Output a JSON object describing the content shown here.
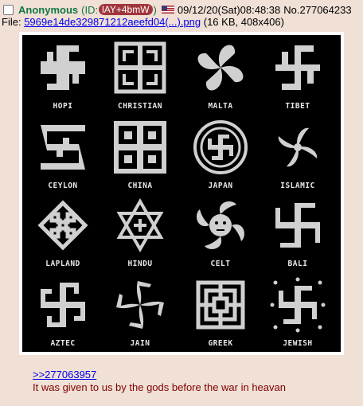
{
  "post": {
    "name": "Anonymous",
    "id_prefix": "(ID:",
    "id_value": "lAY+4bmW",
    "id_suffix": ")",
    "flag_icon": "us-flag-icon",
    "datetime": "09/12/20(Sat)08:48:38",
    "number": "No.277064233",
    "file_label": "File:",
    "file_name": "5969e14de329871212aeefd04(...).png",
    "file_info": "(16 KB, 408x406)",
    "quote_link": ">>277063957",
    "comment": "It was given to us by the gods before the war in heavan"
  },
  "image": {
    "labels": [
      "HOPI",
      "CHRISTIAN",
      "MALTA",
      "TIBET",
      "CEYLON",
      "CHINA",
      "JAPAN",
      "ISLAMIC",
      "LAPLAND",
      "HINDU",
      "CELT",
      "BALI",
      "AZTEC",
      "JAIN",
      "GREEK",
      "JEWISH"
    ]
  },
  "colors": {
    "background": "#f0e0d6",
    "name": "#117743",
    "id_badge": "#a0353c",
    "link": "#0000ee",
    "text": "#800000"
  }
}
